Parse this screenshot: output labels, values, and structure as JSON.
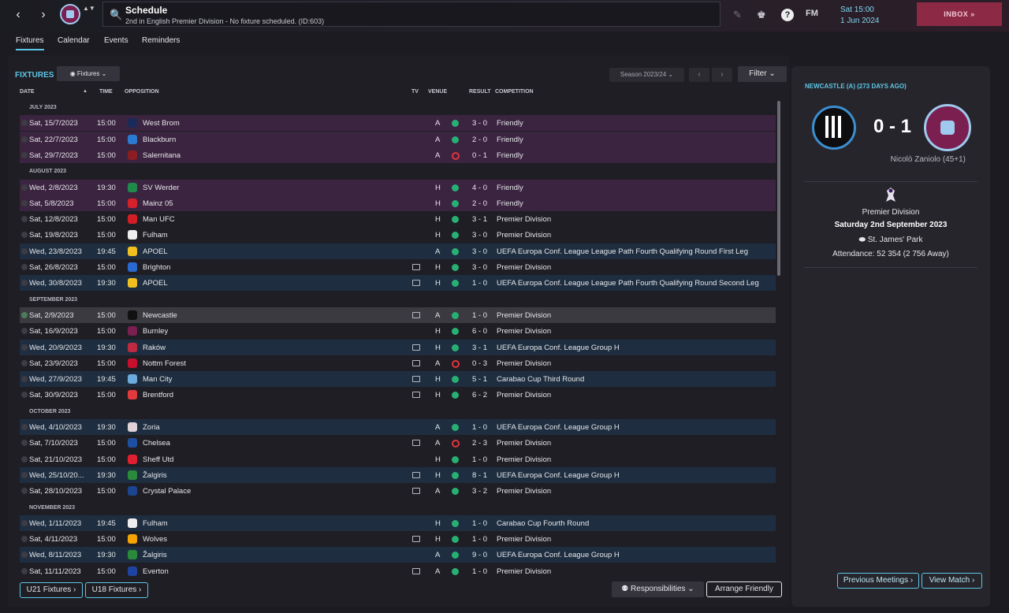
{
  "header": {
    "back_icon": "‹",
    "forward_icon": "›",
    "club_switch_icon": "▲▼",
    "search_icon": "🔍",
    "title": "Schedule",
    "subtitle": "2nd in English Premier Division - No fixture scheduled. (ID:603)",
    "date_line1": "Sat 15:00",
    "date_line2": "1 Jun 2024",
    "fm_label": "FM",
    "help_label": "?",
    "inbox_label": "INBOX",
    "inbox_arrow": "»"
  },
  "tabs": [
    "Fixtures",
    "Calendar",
    "Events",
    "Reminders"
  ],
  "fixtures_panel": {
    "title": "FIXTURES",
    "view_label": "Fixtures",
    "season_label": "Season 2023/24",
    "filter_label": "Filter",
    "prev_icon": "‹",
    "next_icon": "›",
    "dropdown_icon": "⌄",
    "columns": {
      "date": "DATE",
      "sort_icon": "▲",
      "time": "TIME",
      "opposition": "OPPOSITION",
      "tv": "TV",
      "venue": "VENUE",
      "result": "RESULT",
      "competition": "COMPETITION"
    }
  },
  "months": {
    "july": "JULY 2023",
    "august": "AUGUST 2023",
    "september": "SEPTEMBER 2023",
    "october": "OCTOBER 2023",
    "november": "NOVEMBER 2023"
  },
  "fixtures": [
    {
      "date": "Sat, 15/7/2023",
      "time": "15:00",
      "opp": "West Brom",
      "tv": false,
      "venue": "A",
      "result": "3 - 0",
      "outcome": "win",
      "comp": "Friendly",
      "band": "friendly",
      "crest_color": "#1c2a5a"
    },
    {
      "date": "Sat, 22/7/2023",
      "time": "15:00",
      "opp": "Blackburn",
      "tv": false,
      "venue": "A",
      "result": "2 - 0",
      "outcome": "win",
      "comp": "Friendly",
      "band": "friendly",
      "crest_color": "#2a7ad0"
    },
    {
      "date": "Sat, 29/7/2023",
      "time": "15:00",
      "opp": "Salernitana",
      "tv": false,
      "venue": "A",
      "result": "0 - 1",
      "outcome": "loss",
      "comp": "Friendly",
      "band": "friendly",
      "crest_color": "#8a1e22"
    },
    {
      "date": "Wed, 2/8/2023",
      "time": "19:30",
      "opp": "SV Werder",
      "tv": false,
      "venue": "H",
      "result": "4 - 0",
      "outcome": "win",
      "comp": "Friendly",
      "band": "friendly",
      "crest_color": "#1f8a4a"
    },
    {
      "date": "Sat, 5/8/2023",
      "time": "15:00",
      "opp": "Mainz 05",
      "tv": false,
      "venue": "H",
      "result": "2 - 0",
      "outcome": "win",
      "comp": "Friendly",
      "band": "friendly",
      "crest_color": "#d6202a"
    },
    {
      "date": "Sat, 12/8/2023",
      "time": "15:00",
      "opp": "Man UFC",
      "tv": false,
      "venue": "H",
      "result": "3 - 1",
      "outcome": "win",
      "comp": "Premier Division",
      "band": "plain",
      "crest_color": "#d01e24"
    },
    {
      "date": "Sat, 19/8/2023",
      "time": "15:00",
      "opp": "Fulham",
      "tv": false,
      "venue": "H",
      "result": "3 - 0",
      "outcome": "win",
      "comp": "Premier Division",
      "band": "plain",
      "crest_color": "#eeeeee"
    },
    {
      "date": "Wed, 23/8/2023",
      "time": "19:45",
      "opp": "APOEL",
      "tv": false,
      "venue": "A",
      "result": "3 - 0",
      "outcome": "win",
      "comp": "UEFA Europa Conf. League League Path Fourth Qualifying Round First Leg",
      "band": "europe",
      "crest_color": "#f0c020"
    },
    {
      "date": "Sat, 26/8/2023",
      "time": "15:00",
      "opp": "Brighton",
      "tv": true,
      "venue": "H",
      "result": "3 - 0",
      "outcome": "win",
      "comp": "Premier Division",
      "band": "plain",
      "crest_color": "#2a6ad0"
    },
    {
      "date": "Wed, 30/8/2023",
      "time": "19:30",
      "opp": "APOEL",
      "tv": true,
      "venue": "H",
      "result": "1 - 0",
      "outcome": "win",
      "comp": "UEFA Europa Conf. League League Path Fourth Qualifying Round Second Leg",
      "band": "europe",
      "crest_color": "#f0c020"
    },
    {
      "date": "Sat, 2/9/2023",
      "time": "15:00",
      "opp": "Newcastle",
      "tv": true,
      "venue": "A",
      "result": "1 - 0",
      "outcome": "win",
      "comp": "Premier Division",
      "band": "selected",
      "crest_color": "#111111"
    },
    {
      "date": "Sat, 16/9/2023",
      "time": "15:00",
      "opp": "Burnley",
      "tv": false,
      "venue": "H",
      "result": "6 - 0",
      "outcome": "win",
      "comp": "Premier Division",
      "band": "plain",
      "crest_color": "#7a1f4f"
    },
    {
      "date": "Wed, 20/9/2023",
      "time": "19:30",
      "opp": "Raków",
      "tv": true,
      "venue": "H",
      "result": "3 - 1",
      "outcome": "win",
      "comp": "UEFA Europa Conf. League Group H",
      "band": "europe",
      "crest_color": "#c02a40"
    },
    {
      "date": "Sat, 23/9/2023",
      "time": "15:00",
      "opp": "Nottm Forest",
      "tv": true,
      "venue": "A",
      "result": "0 - 3",
      "outcome": "loss",
      "comp": "Premier Division",
      "band": "plain",
      "crest_color": "#c8102e"
    },
    {
      "date": "Wed, 27/9/2023",
      "time": "19:45",
      "opp": "Man City",
      "tv": true,
      "venue": "H",
      "result": "5 - 1",
      "outcome": "win",
      "comp": "Carabao Cup Third Round",
      "band": "europe",
      "crest_color": "#6cabdd"
    },
    {
      "date": "Sat, 30/9/2023",
      "time": "15:00",
      "opp": "Brentford",
      "tv": true,
      "venue": "H",
      "result": "6 - 2",
      "outcome": "win",
      "comp": "Premier Division",
      "band": "plain",
      "crest_color": "#e03a3e"
    },
    {
      "date": "Wed, 4/10/2023",
      "time": "19:30",
      "opp": "Zoria",
      "tv": false,
      "venue": "A",
      "result": "1 - 0",
      "outcome": "win",
      "comp": "UEFA Europa Conf. League Group H",
      "band": "europe",
      "crest_color": "#e0d0d8"
    },
    {
      "date": "Sat, 7/10/2023",
      "time": "15:00",
      "opp": "Chelsea",
      "tv": true,
      "venue": "A",
      "result": "2 - 3",
      "outcome": "loss",
      "comp": "Premier Division",
      "band": "plain",
      "crest_color": "#1e4fa0"
    },
    {
      "date": "Sat, 21/10/2023",
      "time": "15:00",
      "opp": "Sheff Utd",
      "tv": false,
      "venue": "H",
      "result": "1 - 0",
      "outcome": "win",
      "comp": "Premier Division",
      "band": "plain",
      "crest_color": "#e02030"
    },
    {
      "date": "Wed, 25/10/20...",
      "time": "19:30",
      "opp": "Žalgiris",
      "tv": true,
      "venue": "H",
      "result": "8 - 1",
      "outcome": "win",
      "comp": "UEFA Europa Conf. League Group H",
      "band": "europe",
      "crest_color": "#2a8a3a"
    },
    {
      "date": "Sat, 28/10/2023",
      "time": "15:00",
      "opp": "Crystal Palace",
      "tv": true,
      "venue": "A",
      "result": "3 - 2",
      "outcome": "win",
      "comp": "Premier Division",
      "band": "plain",
      "crest_color": "#1b458f"
    },
    {
      "date": "Wed, 1/11/2023",
      "time": "19:45",
      "opp": "Fulham",
      "tv": false,
      "venue": "H",
      "result": "1 - 0",
      "outcome": "win",
      "comp": "Carabao Cup Fourth Round",
      "band": "europe",
      "crest_color": "#eeeeee"
    },
    {
      "date": "Sat, 4/11/2023",
      "time": "15:00",
      "opp": "Wolves",
      "tv": true,
      "venue": "H",
      "result": "1 - 0",
      "outcome": "win",
      "comp": "Premier Division",
      "band": "plain",
      "crest_color": "#f4a300"
    },
    {
      "date": "Wed, 8/11/2023",
      "time": "19:30",
      "opp": "Žalgiris",
      "tv": false,
      "venue": "A",
      "result": "9 - 0",
      "outcome": "win",
      "comp": "UEFA Europa Conf. League Group H",
      "band": "europe",
      "crest_color": "#2a8a3a"
    },
    {
      "date": "Sat, 11/11/2023",
      "time": "15:00",
      "opp": "Everton",
      "tv": true,
      "venue": "A",
      "result": "1 - 0",
      "outcome": "win",
      "comp": "Premier Division",
      "band": "plain",
      "crest_color": "#1f43a0"
    }
  ],
  "footer": {
    "u21": "U21 Fixtures ›",
    "u18": "U18 Fixtures ›",
    "responsibilities": "Responsibilities ⌄",
    "arrange": "Arrange Friendly"
  },
  "side": {
    "title": "NEWCASTLE (A) (273 DAYS AGO)",
    "score": "0 - 1",
    "scorer": "Nicolò Zaniolo (45+1)",
    "competition": "Premier Division",
    "date": "Saturday 2nd September 2023",
    "stadium": "St. James' Park",
    "attendance": "Attendance: 52 354 (2 756 Away)",
    "prev_btn": "Previous Meetings ›",
    "view_btn": "View Match ›"
  },
  "colors": {
    "accent": "#5ec6e6",
    "win": "#27b074",
    "loss": "#e0343c",
    "inbox": "#8c2a45"
  }
}
